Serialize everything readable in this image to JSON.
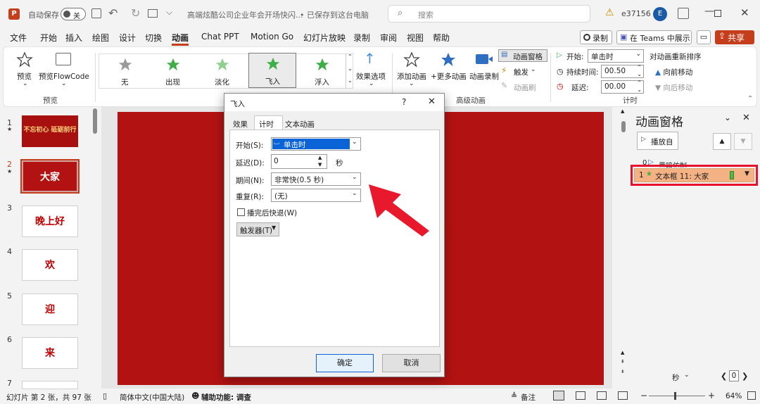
{
  "titlebar": {
    "autosave_label": "自动保存",
    "autosave_state": "关",
    "doc_title": "高端炫酷公司企业年会开场快闪...",
    "save_status": "• 已保存到这台电脑",
    "search_placeholder": "搜索",
    "user": "e37156",
    "user_initial": "E"
  },
  "ribbon_tabs": [
    "文件",
    "开始",
    "插入",
    "绘图",
    "设计",
    "切换",
    "动画",
    "Chat PPT",
    "Motion Go",
    "幻灯片放映",
    "录制",
    "审阅",
    "视图",
    "帮助"
  ],
  "active_tab": "动画",
  "ribbon_right": {
    "record": "录制",
    "teams": "在 Teams 中展示",
    "share": "共享"
  },
  "preview_group": {
    "preview": "预览",
    "preview_flowcode": "预览FlowCode",
    "label": "预览"
  },
  "animations": [
    "无",
    "出现",
    "淡化",
    "飞入",
    "浮入"
  ],
  "effect_options": "效果选项",
  "advanced": {
    "add_animation": "添加动画",
    "more_animation": "+更多动画",
    "anim_record": "动画录制",
    "anim_pane": "动画窗格",
    "trigger": "触发",
    "anim_painter": "动画刷",
    "label": "高级动画"
  },
  "timing": {
    "start_label": "开始:",
    "start_value": "单击时",
    "duration_label": "持续时间:",
    "duration_value": "00.50",
    "delay_label": "延迟:",
    "delay_value": "00.00",
    "reorder": "对动画重新排序",
    "move_earlier": "向前移动",
    "move_later": "向后移动",
    "label": "计时"
  },
  "slides": [
    {
      "num": "1",
      "text": "不忘初心 砥砺前行",
      "star": true
    },
    {
      "num": "2",
      "text": "大家",
      "star": true
    },
    {
      "num": "3",
      "text": "晚上好",
      "star": false
    },
    {
      "num": "4",
      "text": "欢",
      "star": false
    },
    {
      "num": "5",
      "text": "迎",
      "star": false
    },
    {
      "num": "6",
      "text": "来",
      "star": false
    },
    {
      "num": "7",
      "text": "",
      "star": false
    }
  ],
  "dialog": {
    "title": "飞入",
    "help": "?",
    "tabs": [
      "效果",
      "计时",
      "文本动画"
    ],
    "start_label": "开始(S):",
    "start_value": "单击时",
    "delay_label": "延迟(D):",
    "delay_value": "0",
    "delay_unit": "秒",
    "duration_label": "期间(N):",
    "duration_value": "非常快(0.5 秒)",
    "repeat_label": "重复(R):",
    "repeat_value": "(无)",
    "rewind_label": "播完后快退(W)",
    "trigger_label": "触发器(T)",
    "ok": "确定",
    "cancel": "取消"
  },
  "anim_pane": {
    "title": "动画窗格",
    "play_from": "播放自",
    "item0_num": "0",
    "item0_label": "黑暗仿制",
    "item1_num": "1",
    "item1_label": "文本框 11: 大家",
    "seconds_label": "秒",
    "page_value": "0"
  },
  "status": {
    "slide_info": "幻灯片 第 2 张，共 97 张",
    "language": "简体中文(中国大陆)",
    "accessibility": "辅助功能: 调查",
    "notes": "备注",
    "zoom": "64%"
  },
  "colors": {
    "accent": "#c43e1c",
    "slide_bg": "#b31212",
    "highlight": "#e8112d",
    "arrow": "#e8192c",
    "selected_anim_bg": "#f4b183"
  }
}
